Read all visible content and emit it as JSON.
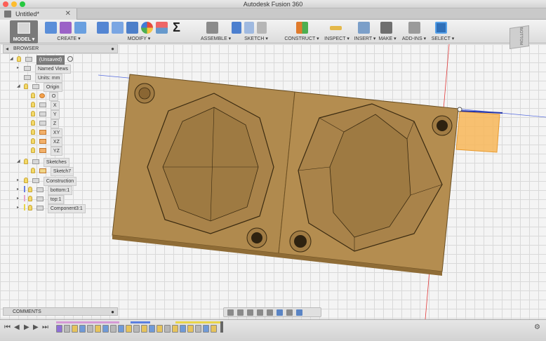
{
  "window": {
    "title": "Autodesk Fusion 360",
    "traffic_colors": [
      "#fc5f57",
      "#fdbc2e",
      "#27c840"
    ]
  },
  "tab": {
    "label": "Untitled*",
    "close": "✕"
  },
  "toolbar": {
    "model_label": "MODEL ▾",
    "groups": [
      {
        "id": "create",
        "label": "CREATE ▾"
      },
      {
        "id": "modify",
        "label": "MODIFY ▾"
      },
      {
        "id": "assemble",
        "label": "ASSEMBLE ▾"
      },
      {
        "id": "sketch",
        "label": "SKETCH ▾"
      },
      {
        "id": "construct",
        "label": "CONSTRUCT ▾"
      },
      {
        "id": "inspect",
        "label": "INSPECT ▾"
      },
      {
        "id": "insert",
        "label": "INSERT ▾"
      },
      {
        "id": "make",
        "label": "MAKE ▾"
      },
      {
        "id": "addins",
        "label": "ADD-INS ▾"
      },
      {
        "id": "select",
        "label": "SELECT ▾"
      }
    ],
    "sigma": "Σ",
    "viewcube_label": "BOTTOM"
  },
  "browser": {
    "title": "BROWSER",
    "items": [
      {
        "label": "(Unsaved)",
        "kind": "root"
      },
      {
        "label": "Named Views",
        "kind": "folder"
      },
      {
        "label": "Units: mm",
        "kind": "doc"
      },
      {
        "label": "Origin",
        "kind": "folder"
      },
      {
        "label": "O",
        "kind": "point"
      },
      {
        "label": "X",
        "kind": "axis"
      },
      {
        "label": "Y",
        "kind": "axis"
      },
      {
        "label": "Z",
        "kind": "axis"
      },
      {
        "label": "XY",
        "kind": "plane"
      },
      {
        "label": "XZ",
        "kind": "plane"
      },
      {
        "label": "YZ",
        "kind": "plane"
      },
      {
        "label": "Sketches",
        "kind": "folder"
      },
      {
        "label": "Sketch7",
        "kind": "sketch"
      },
      {
        "label": "Construction",
        "kind": "folder"
      },
      {
        "label": "bottom:1",
        "kind": "component"
      },
      {
        "label": "top:1",
        "kind": "component"
      },
      {
        "label": "Component3:1",
        "kind": "component"
      }
    ]
  },
  "comments": {
    "title": "COMMENTS"
  },
  "colors": {
    "wood": "#b08a4e",
    "wood_dark": "#8f6c36",
    "selection_orange": "#f7b658",
    "axis_blue": "#3355dd",
    "axis_red": "#e03030"
  }
}
